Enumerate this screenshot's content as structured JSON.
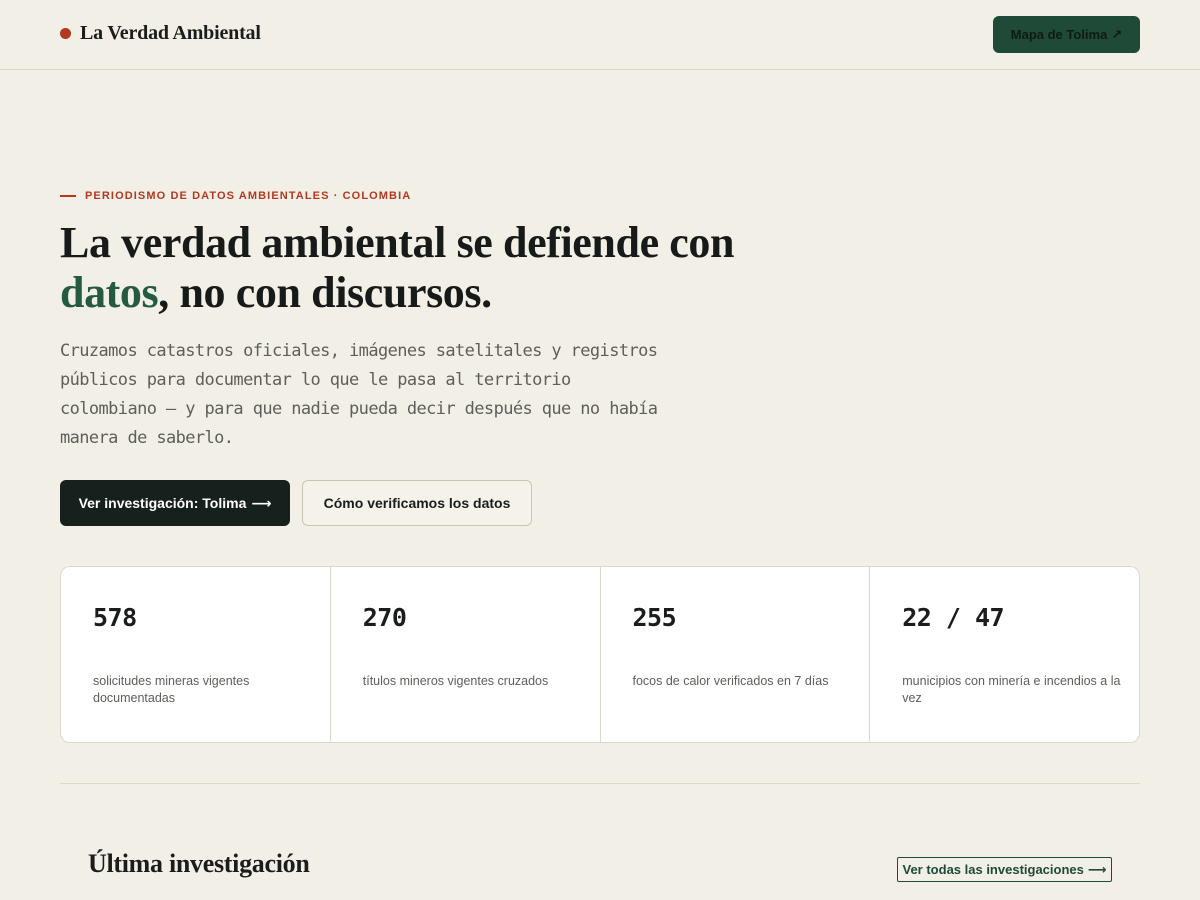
{
  "header": {
    "brand": "La Verdad Ambiental",
    "map_button": "Mapa de Tolima",
    "map_button_icon": "↗"
  },
  "hero": {
    "eyebrow": "PERIODISMO DE DATOS AMBIENTALES · COLOMBIA",
    "title_part1": "La verdad ambiental se defiende con ",
    "title_accent": "datos",
    "title_part2": ", no con discursos.",
    "lead": "Cruzamos catastros oficiales, imágenes satelitales y registros públicos para documentar lo que le pasa al territorio colombiano — y para que nadie pueda decir después que no había manera de saberlo.",
    "primary_button": "Ver investigación: Tolima",
    "primary_button_icon": "⟶",
    "secondary_button": "Cómo verificamos los datos"
  },
  "stats": [
    {
      "value": "578",
      "label": "solicitudes mineras vigentes documentadas"
    },
    {
      "value": "270",
      "label": "títulos mineros vigentes cruzados"
    },
    {
      "value": "255",
      "label": "focos de calor verificados en 7 días"
    },
    {
      "value": "22 / 47",
      "label": "municipios con minería e incendios a la vez"
    }
  ],
  "latest": {
    "title": "Última investigación",
    "all_link": "Ver todas las investigaciones",
    "all_link_icon": "⟶"
  },
  "colors": {
    "background": "#f2efe7",
    "accent_red": "#b1391f",
    "accent_green": "#245a40",
    "dark_button": "#16201c"
  }
}
